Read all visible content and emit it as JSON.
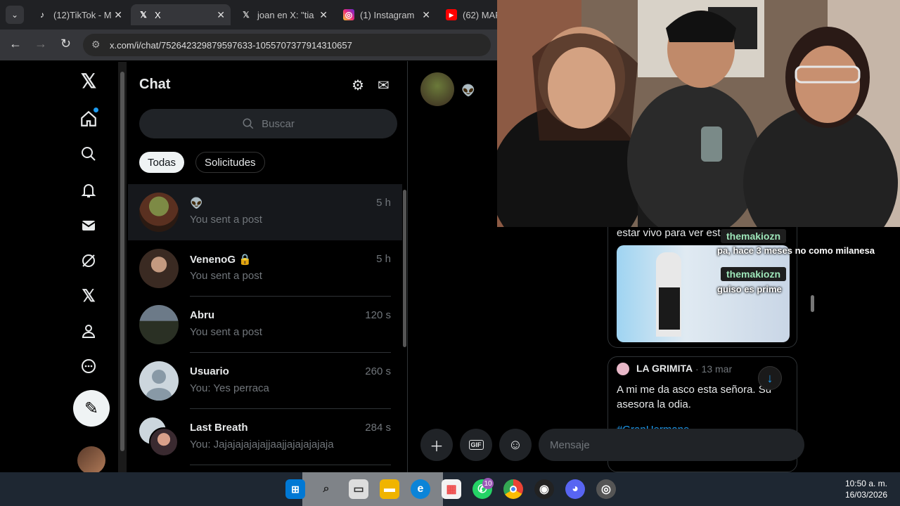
{
  "browser": {
    "tabs": [
      {
        "label": "(12)TikTok - M",
        "icon": "tiktok-icon"
      },
      {
        "label": "X",
        "icon": "x-icon"
      },
      {
        "label": "joan en X: \"tia",
        "icon": "x-icon"
      },
      {
        "label": "(1) Instagram",
        "icon": "instagram-icon"
      },
      {
        "label": "(62) MARC",
        "icon": "youtube-icon"
      }
    ],
    "url": "x.com/i/chat/752642329879597633-1055707377914310657"
  },
  "nav": {
    "items": [
      "x-logo-icon",
      "home-icon",
      "search-icon",
      "bell-icon",
      "mail-icon",
      "grok-icon",
      "x-premium-icon",
      "profile-icon",
      "more-icon"
    ]
  },
  "chat": {
    "title": "Chat",
    "search_placeholder": "Buscar",
    "filters": {
      "all": "Todas",
      "requests": "Solicitudes"
    },
    "conversations": [
      {
        "name": "👽",
        "time": "5 h",
        "preview": "You sent a post",
        "selected": true
      },
      {
        "name": "VenenoG 🔒",
        "time": "5 h",
        "preview": "You sent a post"
      },
      {
        "name": "Abru",
        "time": "120 s",
        "preview": "You sent a post"
      },
      {
        "name": "Usuario",
        "time": "260 s",
        "preview": "You: Yes perraca"
      },
      {
        "name": "Last Breath",
        "time": "284 s",
        "preview": "You: Jajajajajajajjaajjajajajajaja"
      }
    ]
  },
  "conversation": {
    "header_emoji": "👽",
    "post1_text": "estar vivo para ver esto",
    "post2": {
      "author": "LA GRIMITA",
      "date": "· 13 mar",
      "body": "A mi me da asco esta señora. Su asesora la odia.",
      "hashtag": "#GranHermano"
    },
    "composer_placeholder": "Mensaje"
  },
  "stream_overlay": {
    "messages": [
      {
        "user": "themakiozn",
        "text": "pa, hace 3 meses no como milanesa"
      },
      {
        "user": "themakiozn",
        "text": "guiso es prime"
      }
    ]
  },
  "taskbar": {
    "badges": {
      "whatsapp": "10"
    },
    "time": "10:50 a. m.",
    "date": "16/03/2026"
  }
}
